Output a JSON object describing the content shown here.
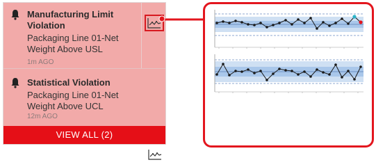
{
  "alerts": [
    {
      "title": "Manufacturing Limit Violation",
      "description": "Packaging Line 01-Net Weight Above USL",
      "time": "1m AGO",
      "icon": "bell-icon",
      "chart_icon": "control-chart-icon"
    },
    {
      "title": "Statistical Violation",
      "description": "Packaging Line 01-Net Weight Above UCL",
      "time": "12m AGO",
      "icon": "bell-icon",
      "chart_icon": "control-chart-icon"
    }
  ],
  "view_all_label": "VIEW ALL (2)",
  "colors": {
    "panel_background": "#f2aaa9",
    "view_all_background": "#e50f17",
    "highlight_border": "#e3161e",
    "chart_band": "#b9d3ee",
    "chart_line": "#1a1a1a",
    "point_usl": "#2bb3c8",
    "point_violation": "#e3161e"
  }
}
